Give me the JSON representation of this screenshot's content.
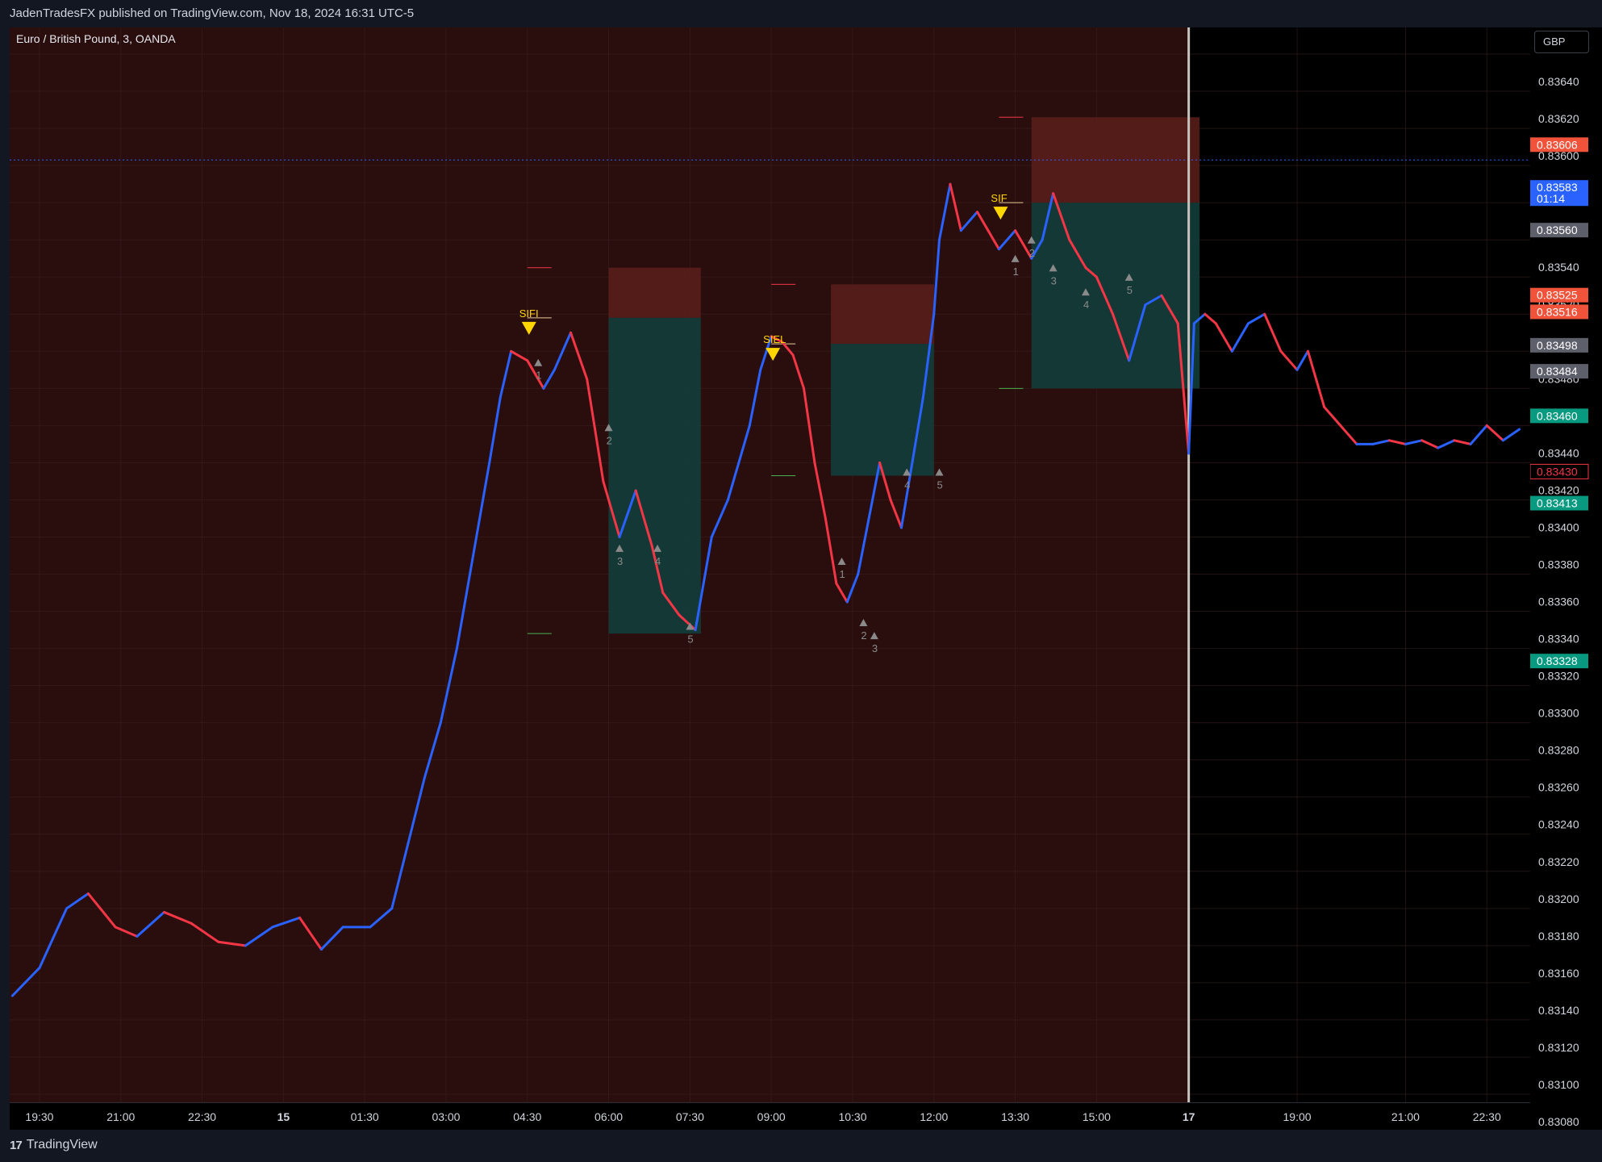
{
  "header": {
    "published": "JadenTradesFX published on TradingView.com, Nov 18, 2024 16:31 UTC-5"
  },
  "chart_title": "Euro / British Pound, 3, OANDA",
  "currency": "GBP",
  "footer": {
    "logo_mark": "17",
    "brand": "TradingView"
  },
  "colors": {
    "bull": "#2962ff",
    "bear": "#f23645",
    "session_bg": "#2a0e0e",
    "after_bg": "#000000",
    "risk_box": "#5a1e1a",
    "reward_box": "#123d3a",
    "signal": "#ffd600"
  },
  "chart_data": {
    "type": "line",
    "ylim": [
      0.8308,
      0.8365
    ],
    "y_ticks": [
      "0.83640",
      "0.83620",
      "0.83600",
      "0.83580",
      "0.83560",
      "0.83540",
      "0.83520",
      "0.83500",
      "0.83480",
      "0.83460",
      "0.83440",
      "0.83420",
      "0.83400",
      "0.83380",
      "0.83360",
      "0.83340",
      "0.83320",
      "0.83300",
      "0.83280",
      "0.83260",
      "0.83240",
      "0.83220",
      "0.83200",
      "0.83180",
      "0.83160",
      "0.83140",
      "0.83120",
      "0.83100",
      "0.83080"
    ],
    "x_ticks": [
      {
        "label": "19:30",
        "t": 18.5
      },
      {
        "label": "21:00",
        "t": 20
      },
      {
        "label": "22:30",
        "t": 21.5
      },
      {
        "label": "15",
        "t": 23,
        "bold": true
      },
      {
        "label": "01:30",
        "t": 24.5
      },
      {
        "label": "03:00",
        "t": 26
      },
      {
        "label": "04:30",
        "t": 27.5
      },
      {
        "label": "06:00",
        "t": 29
      },
      {
        "label": "07:30",
        "t": 30.5
      },
      {
        "label": "09:00",
        "t": 32
      },
      {
        "label": "10:30",
        "t": 33.5
      },
      {
        "label": "12:00",
        "t": 35
      },
      {
        "label": "13:30",
        "t": 36.5
      },
      {
        "label": "15:00",
        "t": 38
      },
      {
        "label": "17",
        "t": 39.7,
        "bold": true
      },
      {
        "label": "19:00",
        "t": 41.7
      },
      {
        "label": "21:00",
        "t": 43.7
      },
      {
        "label": "22:30",
        "t": 45.2
      }
    ],
    "session_break_t": 39.7,
    "series": [
      {
        "x": [
          18,
          18.5,
          19,
          19.4,
          19.9,
          20.3,
          20.8,
          21.3,
          21.8,
          22.3,
          22.8,
          23.3,
          23.7,
          24.1,
          24.6,
          25.0,
          25.3,
          25.6,
          25.9,
          26.2,
          26.5,
          26.8,
          27.0,
          27.2,
          27.5,
          27.8,
          28.0,
          28.3,
          28.6,
          28.9,
          29.2,
          29.5,
          29.8,
          30.0,
          30.3,
          30.6,
          30.9,
          31.2,
          31.4,
          31.6,
          31.8,
          32.0,
          32.2,
          32.4,
          32.6,
          32.8,
          33.0,
          33.2,
          33.4,
          33.6,
          33.8,
          34.0,
          34.2,
          34.4,
          34.6,
          34.8,
          35.0,
          35.1,
          35.3,
          35.5,
          35.8,
          36.0,
          36.2,
          36.5,
          36.8,
          37.0,
          37.2,
          37.5,
          37.8,
          38.0,
          38.3,
          38.6,
          38.9,
          39.2,
          39.5,
          39.7,
          39.8,
          40.0,
          40.2,
          40.5,
          40.8,
          41.1,
          41.4,
          41.7,
          41.9,
          42.2,
          42.5,
          42.8,
          43.1,
          43.4,
          43.7,
          44.0,
          44.3,
          44.6,
          44.9,
          45.2,
          45.5,
          45.8
        ],
        "y": [
          0.83133,
          0.83148,
          0.8318,
          0.83188,
          0.8317,
          0.83165,
          0.83178,
          0.83172,
          0.83162,
          0.8316,
          0.8317,
          0.83175,
          0.83158,
          0.8317,
          0.8317,
          0.8318,
          0.83215,
          0.8325,
          0.8328,
          0.8332,
          0.8337,
          0.8342,
          0.83455,
          0.8348,
          0.83475,
          0.8346,
          0.8347,
          0.8349,
          0.83465,
          0.8341,
          0.8338,
          0.83405,
          0.83375,
          0.8335,
          0.83338,
          0.8333,
          0.8338,
          0.834,
          0.8342,
          0.8344,
          0.8347,
          0.83488,
          0.83485,
          0.83478,
          0.8346,
          0.8342,
          0.8339,
          0.83355,
          0.83345,
          0.8336,
          0.8339,
          0.8342,
          0.834,
          0.83385,
          0.8342,
          0.83455,
          0.835,
          0.8354,
          0.8357,
          0.83545,
          0.83555,
          0.83545,
          0.83535,
          0.83545,
          0.8353,
          0.8354,
          0.83565,
          0.8354,
          0.83525,
          0.8352,
          0.835,
          0.83475,
          0.83505,
          0.8351,
          0.83495,
          0.83425,
          0.83495,
          0.835,
          0.83495,
          0.8348,
          0.83495,
          0.835,
          0.8348,
          0.8347,
          0.8348,
          0.8345,
          0.8344,
          0.8343,
          0.8343,
          0.83432,
          0.8343,
          0.83432,
          0.83428,
          0.83432,
          0.8343,
          0.8344,
          0.83432,
          0.83438
        ]
      }
    ],
    "positions": [
      {
        "t0": 29.0,
        "t1": 30.7,
        "stop": 0.83525,
        "entry": 0.83498,
        "target": 0.83328,
        "signal_t": 27.5,
        "signal": "SIFI"
      },
      {
        "t0": 33.1,
        "t1": 35.0,
        "stop": 0.83516,
        "entry": 0.83484,
        "target": 0.83413,
        "signal_t": 32.0,
        "signal": "SIEL"
      },
      {
        "t0": 36.8,
        "t1": 39.9,
        "stop": 0.83606,
        "entry": 0.8356,
        "target": 0.8346,
        "signal_t": 36.2,
        "signal": "SIF"
      }
    ],
    "current_price": 0.83583,
    "countdown": "01:14",
    "price_labels": [
      {
        "value": "0.83606",
        "kind": "stop"
      },
      {
        "value": "0.83583",
        "kind": "current",
        "sub": "01:14"
      },
      {
        "value": "0.83560",
        "kind": "neutral"
      },
      {
        "value": "0.83525",
        "kind": "stop"
      },
      {
        "value": "0.83516",
        "kind": "stop"
      },
      {
        "value": "0.83498",
        "kind": "neutral"
      },
      {
        "value": "0.83484",
        "kind": "neutral"
      },
      {
        "value": "0.83460",
        "kind": "target"
      },
      {
        "value": "0.83430",
        "kind": "last"
      },
      {
        "value": "0.83413",
        "kind": "target"
      },
      {
        "value": "0.83328",
        "kind": "target"
      }
    ],
    "wave_labels": [
      {
        "t": 27.7,
        "y": 0.83472,
        "text": "1"
      },
      {
        "t": 29.0,
        "y": 0.83437,
        "text": "2"
      },
      {
        "t": 29.2,
        "y": 0.83372,
        "text": "3"
      },
      {
        "t": 29.9,
        "y": 0.83372,
        "text": "4"
      },
      {
        "t": 30.5,
        "y": 0.8333,
        "text": "5"
      },
      {
        "t": 33.3,
        "y": 0.83365,
        "text": "1"
      },
      {
        "t": 33.7,
        "y": 0.83332,
        "text": "2"
      },
      {
        "t": 33.9,
        "y": 0.83325,
        "text": "3"
      },
      {
        "t": 34.5,
        "y": 0.83413,
        "text": "4"
      },
      {
        "t": 35.1,
        "y": 0.83413,
        "text": "5"
      },
      {
        "t": 36.5,
        "y": 0.83528,
        "text": "1"
      },
      {
        "t": 36.8,
        "y": 0.83538,
        "text": "2"
      },
      {
        "t": 37.2,
        "y": 0.83523,
        "text": "3"
      },
      {
        "t": 37.8,
        "y": 0.8351,
        "text": "4"
      },
      {
        "t": 38.6,
        "y": 0.83518,
        "text": "5"
      }
    ]
  }
}
